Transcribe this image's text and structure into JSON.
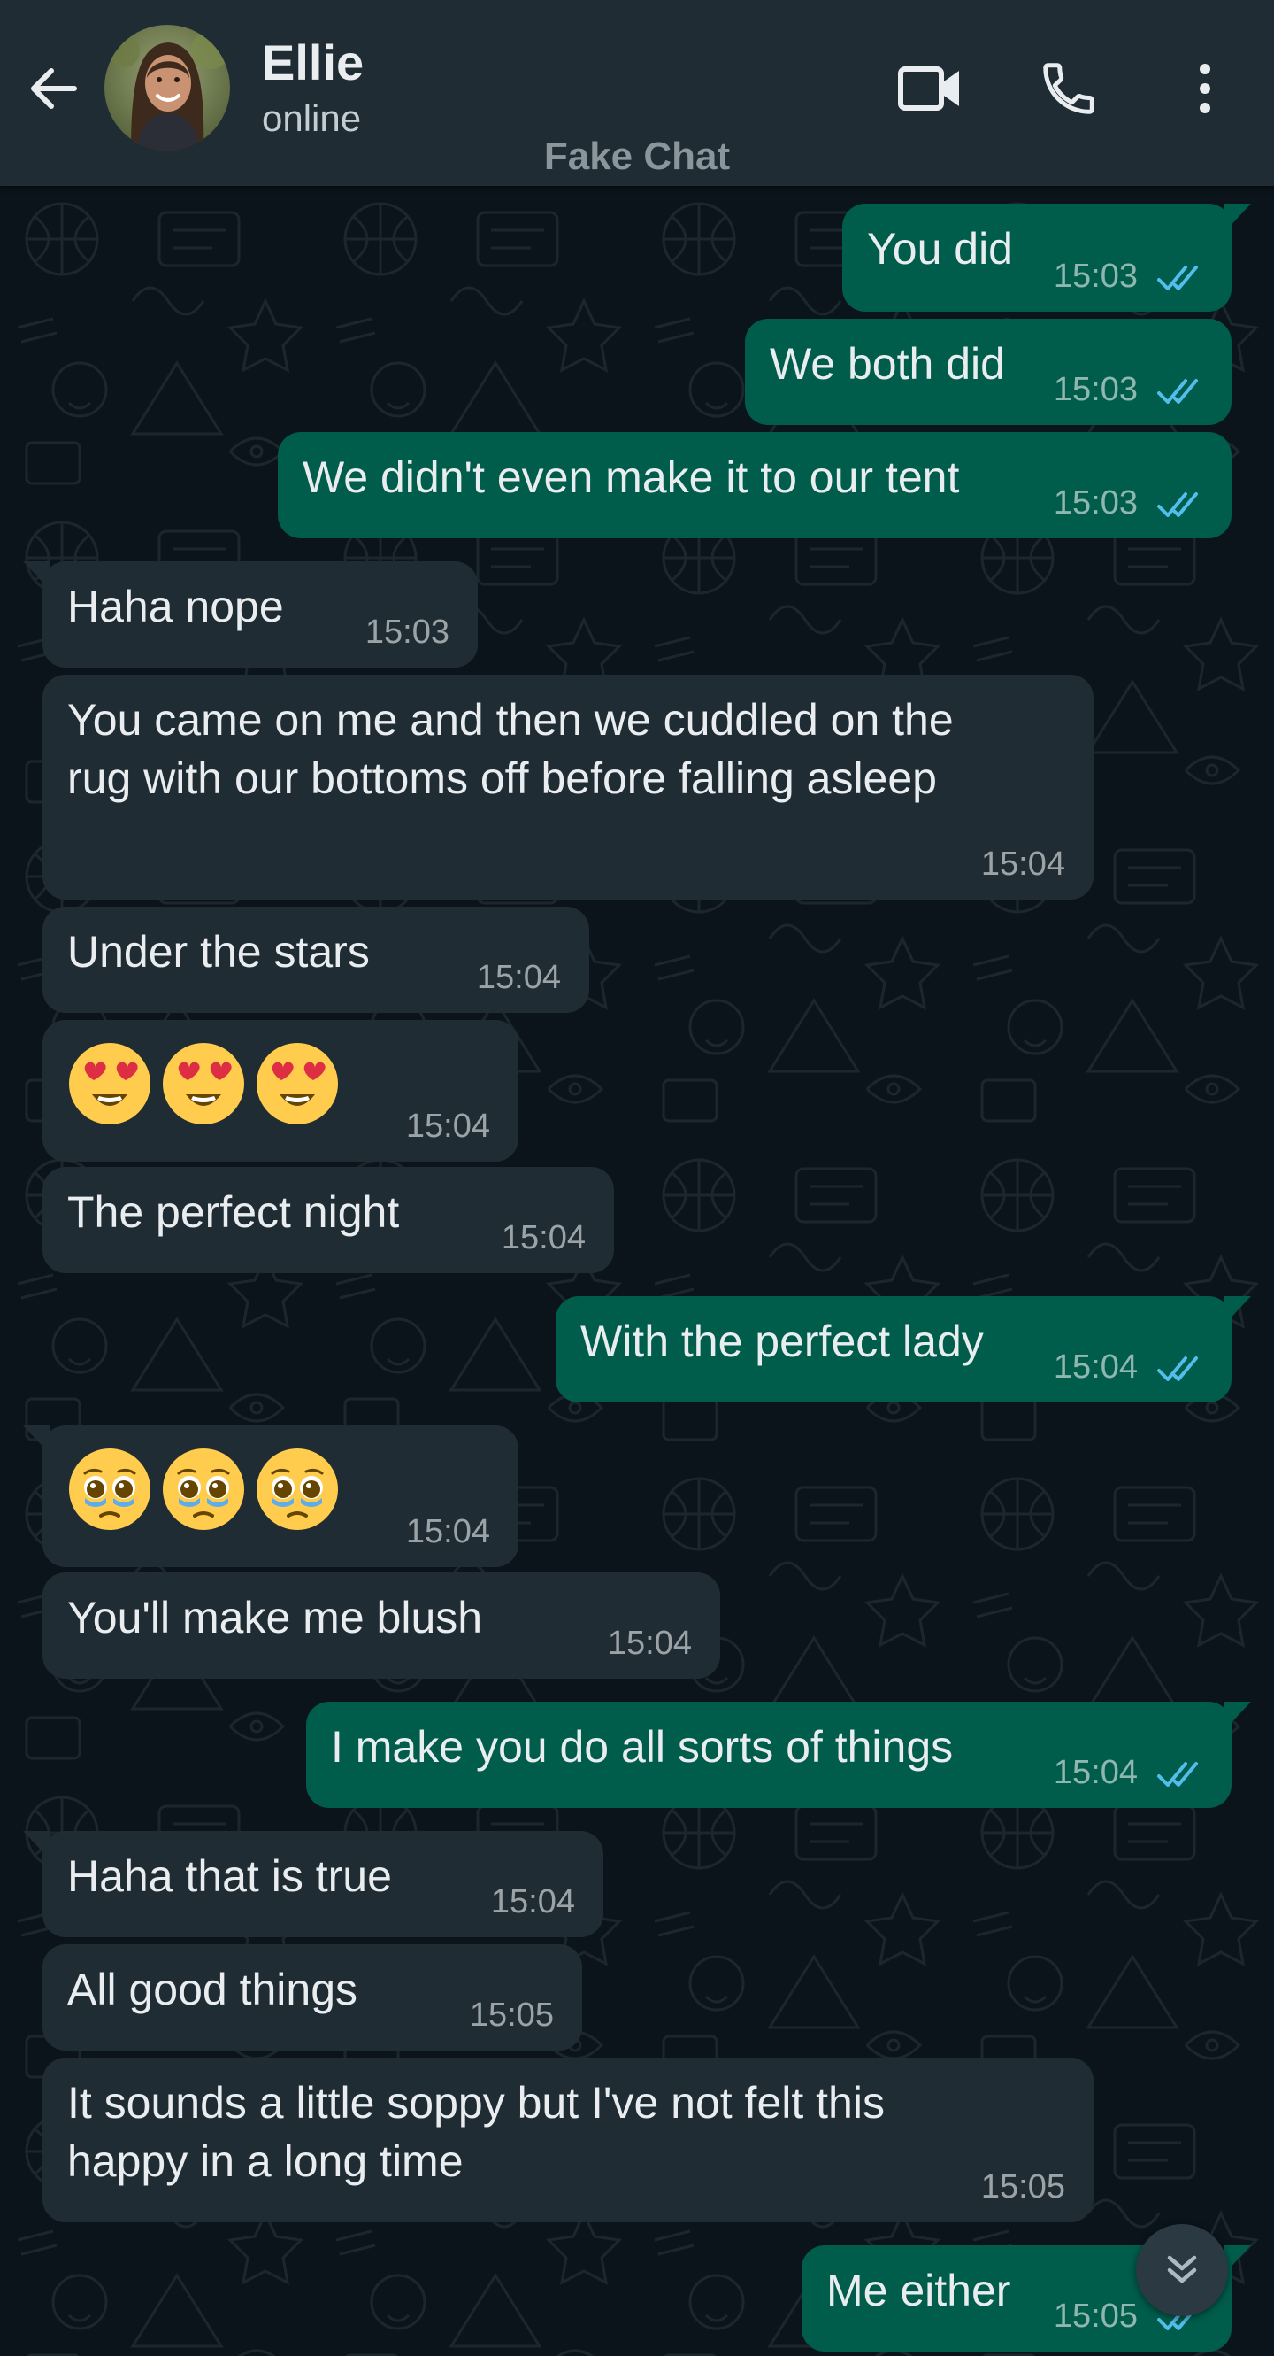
{
  "header": {
    "contact_name": "Ellie",
    "status": "online",
    "watermark": "Fake Chat",
    "icons": [
      "back-arrow-icon",
      "video-call-icon",
      "voice-call-icon",
      "more-options-icon"
    ]
  },
  "colors": {
    "header_bg": "#1f2c34",
    "chat_bg": "#0b141a",
    "outgoing_bubble": "#005c4b",
    "incoming_bubble": "#202c33",
    "read_ticks": "#53bdeb",
    "text": "#e9edef"
  },
  "messages": [
    {
      "dir": "out",
      "text": "You did",
      "time": "15:03",
      "read": true
    },
    {
      "dir": "out",
      "text": "We both did",
      "time": "15:03",
      "read": true
    },
    {
      "dir": "out",
      "text": "We didn't even make it to our tent",
      "time": "15:03",
      "read": true
    },
    {
      "dir": "in",
      "text": "Haha nope",
      "time": "15:03"
    },
    {
      "dir": "in",
      "text": "You came on me and then we cuddled on the rug with our bottoms off before falling asleep",
      "line1": "You came on me and then we cuddled on the",
      "line2": "rug with our bottoms off before falling asleep",
      "time": "15:04"
    },
    {
      "dir": "in",
      "text": "Under the stars",
      "time": "15:04"
    },
    {
      "dir": "in",
      "emoji": "heart-eyes-emoji x3",
      "time": "15:04"
    },
    {
      "dir": "in",
      "text": "The perfect night",
      "time": "15:04"
    },
    {
      "dir": "out",
      "text": "With the perfect lady",
      "time": "15:04",
      "read": true
    },
    {
      "dir": "in",
      "emoji": "pleading-face-emoji x3",
      "time": "15:04"
    },
    {
      "dir": "in",
      "text": "You'll make me blush",
      "time": "15:04"
    },
    {
      "dir": "out",
      "text": "I make you do all sorts of things",
      "time": "15:04",
      "read": true
    },
    {
      "dir": "in",
      "text": "Haha that is true",
      "time": "15:04"
    },
    {
      "dir": "in",
      "text": "All good things",
      "time": "15:05"
    },
    {
      "dir": "in",
      "text": "It sounds a little soppy but I've not felt this happy in a long time",
      "line1": "It sounds a little soppy but I've not felt this",
      "line2": "happy in a long time",
      "time": "15:05"
    },
    {
      "dir": "out",
      "text": "Me either",
      "time": "15:05",
      "read": true
    }
  ],
  "scroll_button": "double-chevron-down-icon"
}
